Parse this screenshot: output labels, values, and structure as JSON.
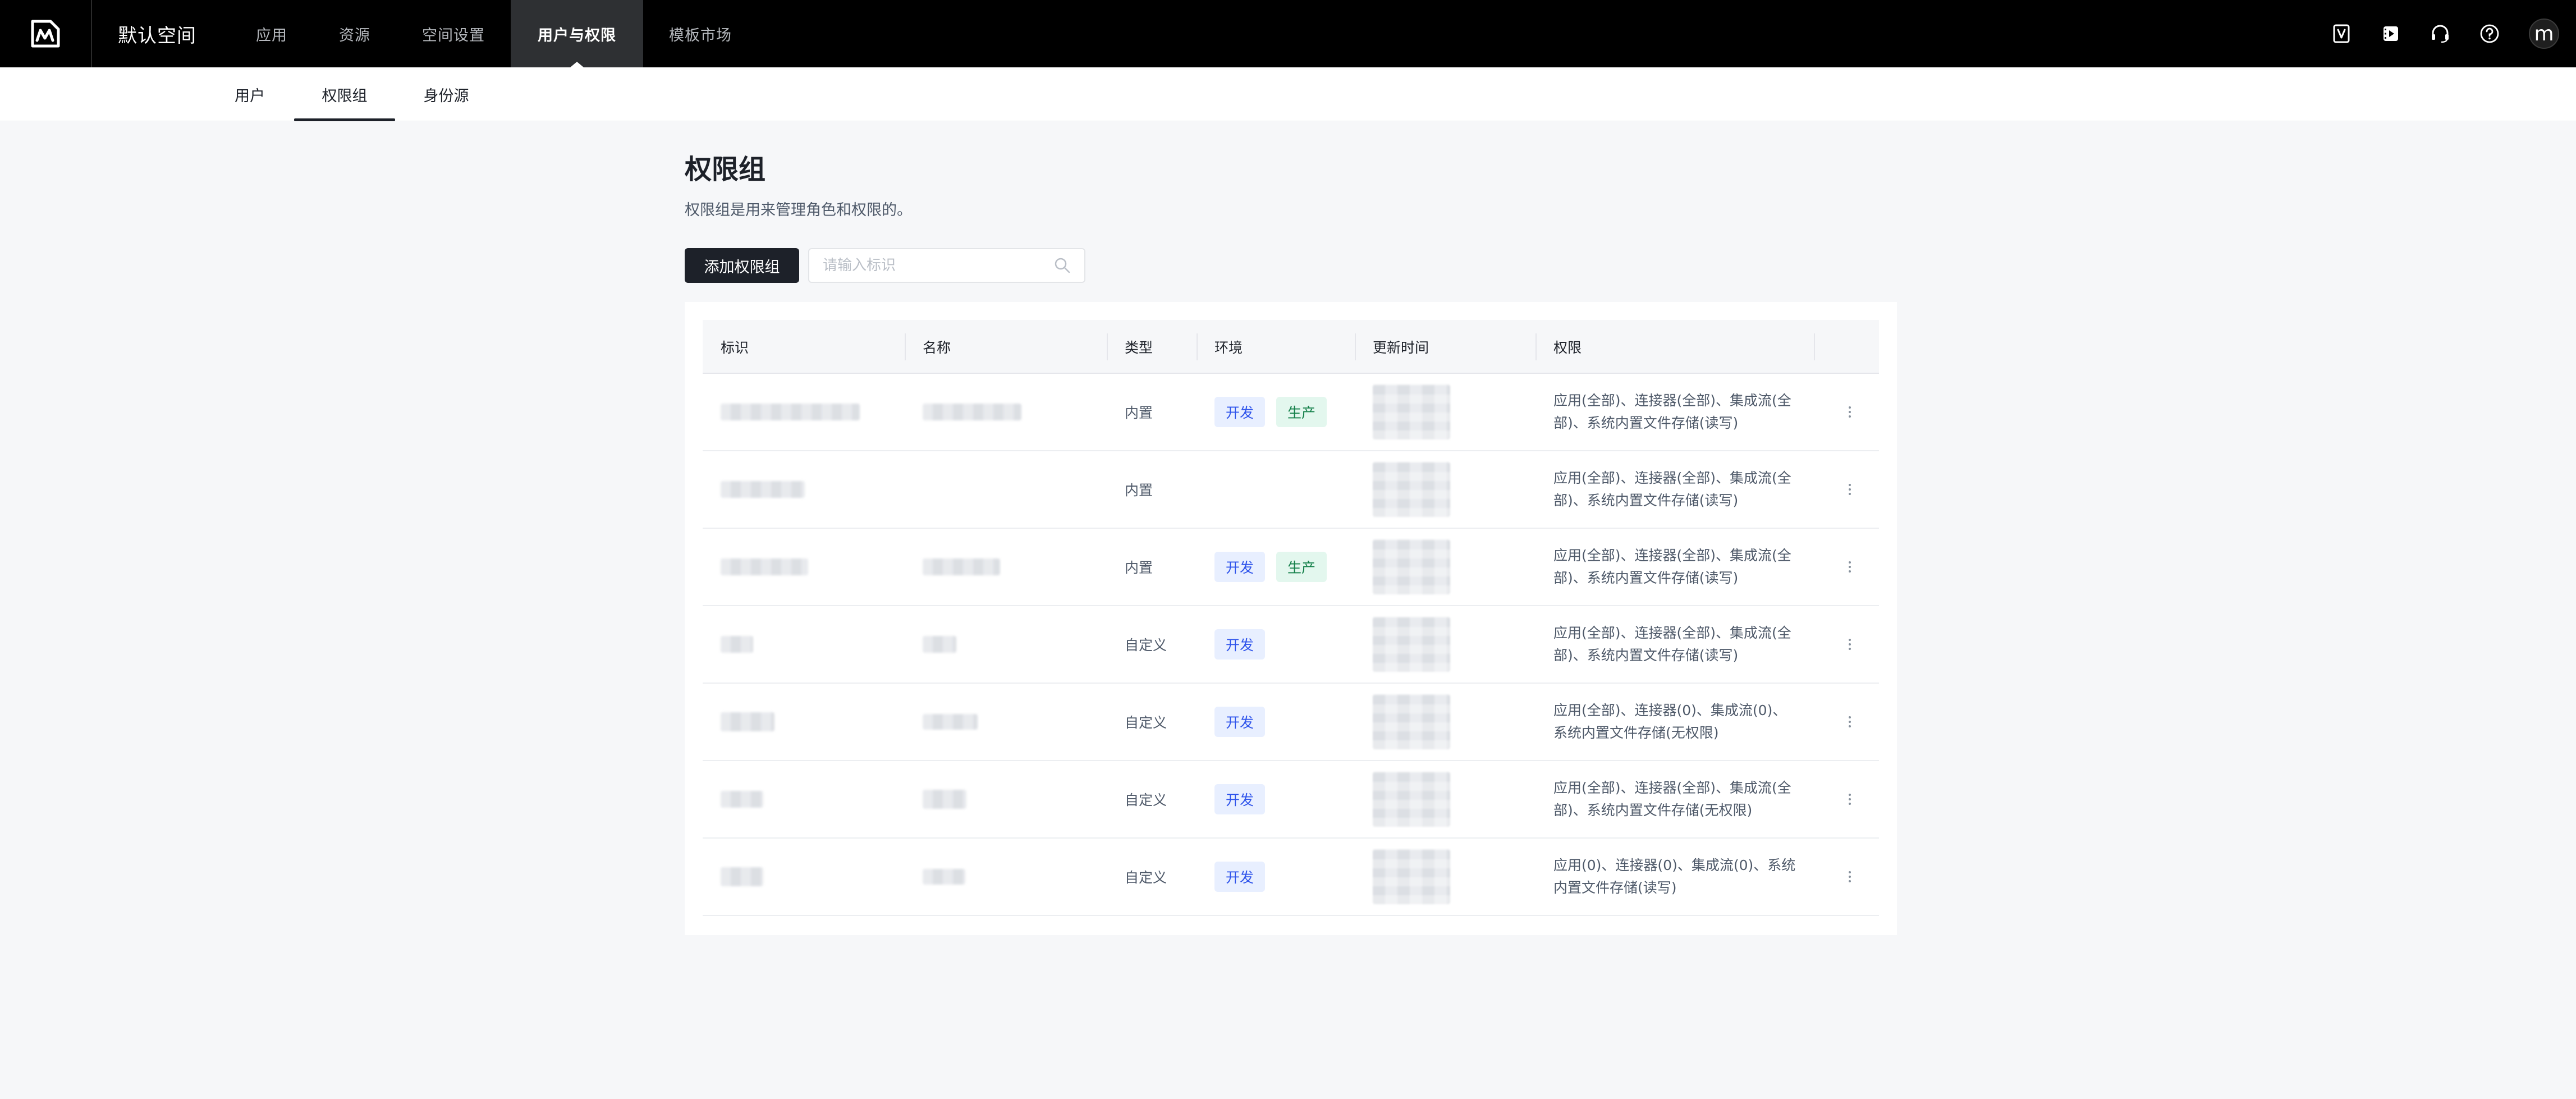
{
  "topbar": {
    "space_name": "默认空间",
    "nav": [
      "应用",
      "资源",
      "空间设置",
      "用户与权限",
      "模板市场"
    ],
    "avatar_letter": "m",
    "icons": [
      "v-badge-icon",
      "video-icon",
      "headset-icon",
      "help-icon"
    ]
  },
  "subtabs": [
    "用户",
    "权限组",
    "身份源"
  ],
  "page": {
    "title": "权限组",
    "description": "权限组是用来管理角色和权限的。",
    "add_button": "添加权限组",
    "search_placeholder": "请输入标识"
  },
  "table": {
    "columns": [
      "标识",
      "名称",
      "类型",
      "环境",
      "更新时间",
      "权限"
    ],
    "env_labels": {
      "dev": "开发",
      "prod": "生产"
    },
    "rows": [
      {
        "type": "内置",
        "envs": [
          "开发",
          "生产"
        ],
        "perm": [
          "应用(全部)、连接器(全部)、集成流(全",
          "部)、系统内置文件存储(读写)"
        ]
      },
      {
        "type": "内置",
        "envs": [],
        "perm": [
          "应用(全部)、连接器(全部)、集成流(全",
          "部)、系统内置文件存储(读写)"
        ]
      },
      {
        "type": "内置",
        "envs": [
          "开发",
          "生产"
        ],
        "perm": [
          "应用(全部)、连接器(全部)、集成流(全",
          "部)、系统内置文件存储(读写)"
        ]
      },
      {
        "type": "自定义",
        "envs": [
          "开发"
        ],
        "perm": [
          "应用(全部)、连接器(全部)、集成流(全",
          "部)、系统内置文件存储(读写)"
        ]
      },
      {
        "type": "自定义",
        "envs": [
          "开发"
        ],
        "perm": [
          "应用(全部)、连接器(0)、集成流(0)、",
          "系统内置文件存储(无权限)"
        ]
      },
      {
        "type": "自定义",
        "envs": [
          "开发"
        ],
        "perm": [
          "应用(全部)、连接器(全部)、集成流(全",
          "部)、系统内置文件存储(无权限)"
        ]
      },
      {
        "type": "自定义",
        "envs": [
          "开发"
        ],
        "perm": [
          "应用(0)、连接器(0)、集成流(0)、系统",
          "内置文件存储(读写)"
        ]
      }
    ]
  }
}
